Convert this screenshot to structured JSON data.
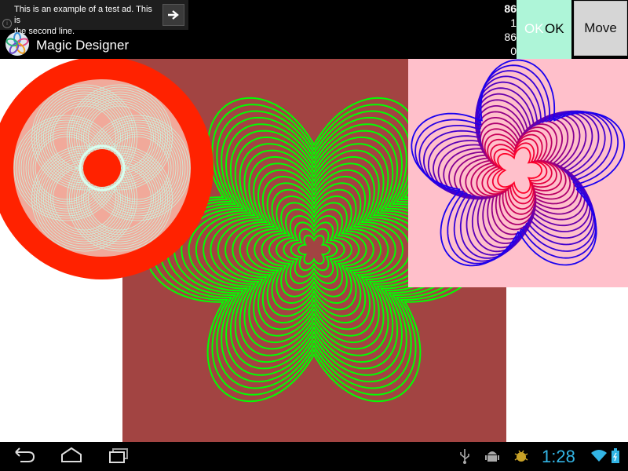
{
  "ad": {
    "line1": "This is an example of a test ad. This is",
    "line2": "the second line.",
    "info_symbol": "i"
  },
  "app": {
    "title": "Magic Designer"
  },
  "counters": [
    "86",
    "1",
    "86",
    "0"
  ],
  "buttons": {
    "ok_ghost_label": "OK",
    "ok_label": "OK",
    "move_label": "Move"
  },
  "status": {
    "time": "1:28"
  },
  "colors": {
    "background": "#ffffff",
    "center_panel": "#a24442",
    "left_disc": "#ff2200",
    "right_panel": "#ffc0cb",
    "green_curve": "#00ff00",
    "ok_button": "#aef5d8",
    "clock": "#33b5e5"
  },
  "icons": {
    "ad_arrow": "arrow-right-icon",
    "app": "pinwheel-app-icon",
    "back": "back-icon",
    "home": "home-icon",
    "recents": "recent-apps-icon",
    "usb": "usb-icon",
    "android": "android-debug-icon",
    "bug": "bug-icon",
    "wifi": "wifi-icon",
    "battery": "battery-icon"
  }
}
